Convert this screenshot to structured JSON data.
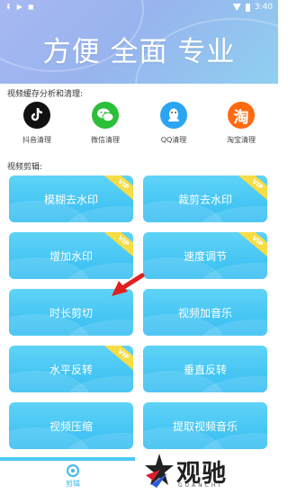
{
  "statusbar": {
    "time": "3:40"
  },
  "header": {
    "slogan": "方便 全面 专业"
  },
  "cache": {
    "title": "视频缓存分析和清理:",
    "items": [
      {
        "label": "抖音清理",
        "icon": "douyin-icon",
        "color": "#111111"
      },
      {
        "label": "微信清理",
        "icon": "wechat-icon",
        "color": "#2bbf3a"
      },
      {
        "label": "QQ清理",
        "icon": "qq-icon",
        "color": "#2ba5f2"
      },
      {
        "label": "淘宝清理",
        "icon": "taobao-icon",
        "color": "#ff6a10",
        "glyph": "淘"
      }
    ]
  },
  "editing": {
    "title": "视频剪辑:",
    "tools": [
      {
        "label": "模糊去水印",
        "vip": true
      },
      {
        "label": "裁剪去水印",
        "vip": true
      },
      {
        "label": "增加水印",
        "vip": true
      },
      {
        "label": "速度调节",
        "vip": true
      },
      {
        "label": "时长剪切",
        "vip": false
      },
      {
        "label": "视频加音乐",
        "vip": false
      },
      {
        "label": "水平反转",
        "vip": true
      },
      {
        "label": "垂直反转",
        "vip": false
      },
      {
        "label": "视频压缩",
        "vip": false
      },
      {
        "label": "提取视频音乐",
        "vip": false
      }
    ],
    "vip_badge": "VIP"
  },
  "tabbar": {
    "active_label": "剪辑"
  },
  "watermark": {
    "brand": "观驰",
    "sub": "GUANCHI"
  },
  "colors": {
    "accent": "#35bdf2",
    "vip": "#f6dc45",
    "arrow": "#e02020"
  }
}
